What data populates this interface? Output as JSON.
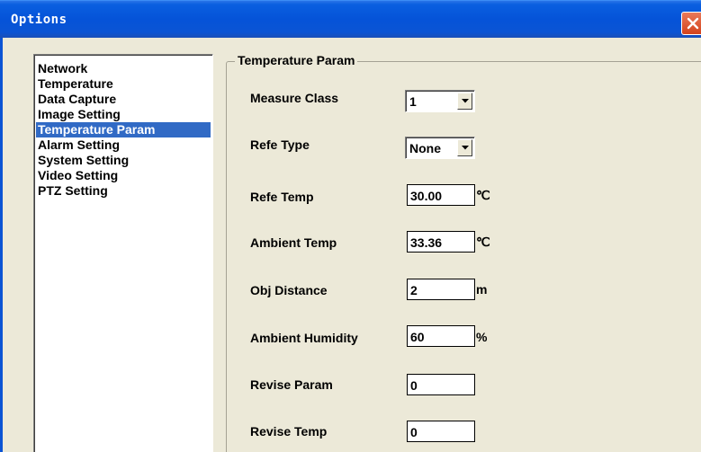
{
  "window": {
    "title": "Options"
  },
  "sidebar": {
    "items": [
      {
        "label": "Network"
      },
      {
        "label": "Temperature"
      },
      {
        "label": "Data Capture"
      },
      {
        "label": "Image Setting"
      },
      {
        "label": "Temperature Param",
        "selected": true
      },
      {
        "label": "Alarm Setting"
      },
      {
        "label": "System Setting"
      },
      {
        "label": "Video Setting"
      },
      {
        "label": "PTZ Setting"
      }
    ]
  },
  "panel": {
    "title": "Temperature Param",
    "measure_class": {
      "label": "Measure Class",
      "value": "1"
    },
    "refe_type": {
      "label": "Refe Type",
      "value": "None"
    },
    "refe_temp": {
      "label": "Refe Temp",
      "value": "30.00",
      "unit": "℃"
    },
    "ambient_temp": {
      "label": "Ambient Temp",
      "value": "33.36",
      "unit": "℃"
    },
    "obj_distance": {
      "label": "Obj Distance",
      "value": "2",
      "unit": "m"
    },
    "ambient_humidity": {
      "label": "Ambient Humidity",
      "value": "60",
      "unit": "%"
    },
    "revise_param": {
      "label": "Revise Param",
      "value": "0"
    },
    "revise_temp": {
      "label": "Revise Temp",
      "value": "0"
    }
  },
  "colors": {
    "titlebar": "#0553d8",
    "selection": "#316ac5",
    "dialog_bg": "#ece9d8",
    "close_button": "#d4431c"
  }
}
